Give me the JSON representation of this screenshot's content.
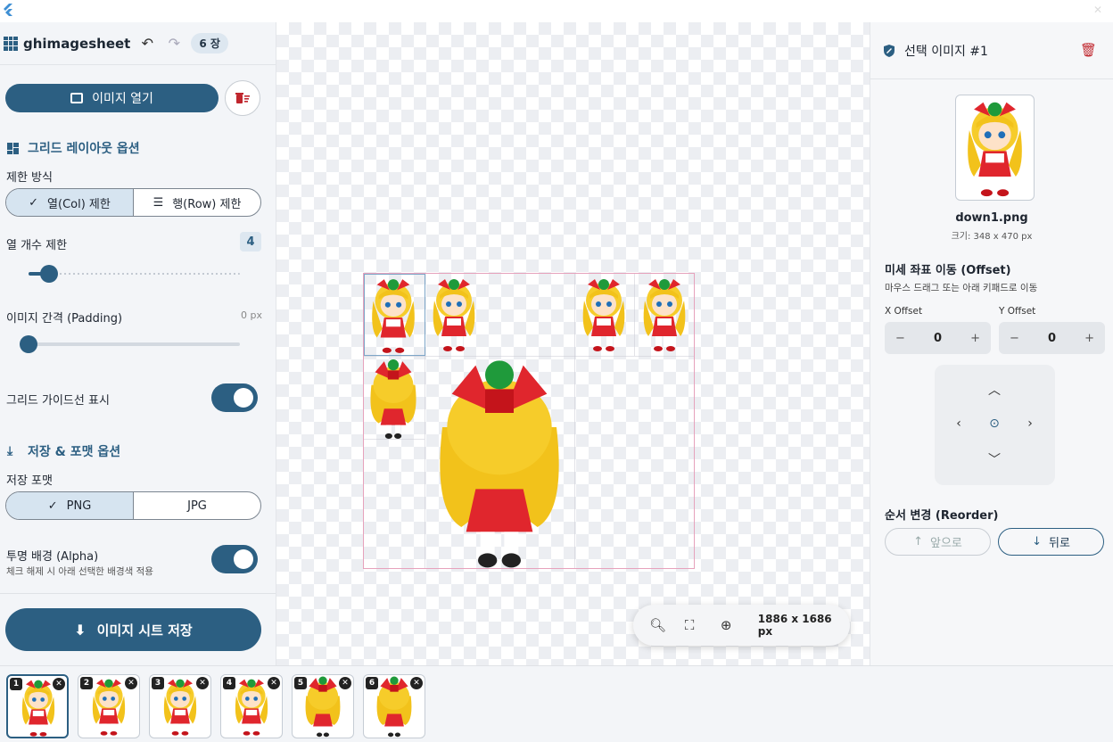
{
  "app": {
    "title": "ghimagesheet",
    "count_badge": "6 장"
  },
  "left": {
    "open_label": "이미지 열기",
    "grid_section": "그리드 레이아웃 옵션",
    "limit_mode_label": "제한 방식",
    "limit_options": [
      "열(Col) 제한",
      "행(Row) 제한"
    ],
    "limit_selected": "열(Col) 제한",
    "col_limit_label": "열 개수 제한",
    "col_limit_value": "4",
    "padding_label": "이미지 간격 (Padding)",
    "padding_value": "0 px",
    "guide_label": "그리드 가이드선 표시",
    "guide_on": true,
    "save_section": "저장 & 포맷 옵션",
    "format_label": "저장 포맷",
    "format_options": [
      "PNG",
      "JPG"
    ],
    "format_selected": "PNG",
    "alpha_label": "투명 배경 (Alpha)",
    "alpha_sub": "체크 해제 시 아래 선택한 배경색 적용",
    "alpha_on": true,
    "save_label": "이미지 시트 저장"
  },
  "canvas": {
    "dimensions": "1886 x 1686 px"
  },
  "right": {
    "title": "선택 이미지 #1",
    "file_name": "down1.png",
    "file_size": "크기: 348 x 470 px",
    "offset_title": "미세 좌표 이동 (Offset)",
    "offset_sub": "마우스 드래그 또는 아래 키패드로 이동",
    "x_label": "X Offset",
    "x_value": "0",
    "y_label": "Y Offset",
    "y_value": "0",
    "reorder_title": "순서 변경 (Reorder)",
    "forward_label": "앞으로",
    "back_label": "뒤로"
  },
  "thumbnails": [
    {
      "num": "1",
      "active": true
    },
    {
      "num": "2",
      "active": false
    },
    {
      "num": "3",
      "active": false
    },
    {
      "num": "4",
      "active": false
    },
    {
      "num": "5",
      "active": false
    },
    {
      "num": "6",
      "active": false
    }
  ],
  "colors": {
    "primary": "#2c5f82",
    "danger": "#c0262d",
    "selected": "#d6e4f0",
    "sheet_border": "#e6a2bc"
  }
}
